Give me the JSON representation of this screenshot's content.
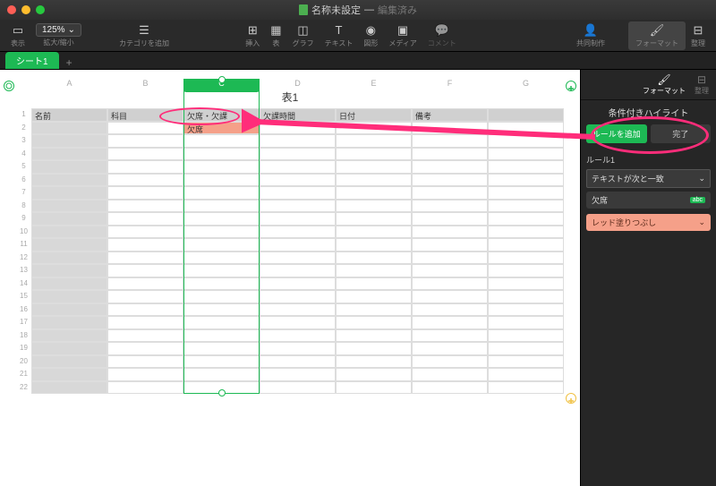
{
  "window": {
    "title": "名称未設定",
    "edited": "編集済み"
  },
  "toolbar": {
    "view": "表示",
    "zoom": "125%",
    "zoom_lbl": "拡大/縮小",
    "category": "カテゴリを追加",
    "insert": "挿入",
    "table": "表",
    "chart": "グラフ",
    "text": "テキスト",
    "shape": "図形",
    "media": "メディア",
    "comment": "コメント",
    "collab": "共同制作",
    "format": "フォーマット",
    "organize": "整理"
  },
  "tabs": {
    "sheet1": "シート1"
  },
  "table": {
    "title": "表1",
    "cols": [
      "A",
      "B",
      "C",
      "D",
      "E",
      "F",
      "G"
    ],
    "headers": [
      "名前",
      "科目",
      "欠席・欠課",
      "欠課時間",
      "日付",
      "備考",
      ""
    ],
    "row2_c": "欠席",
    "row_count": 22
  },
  "sidebar": {
    "format": "フォーマット",
    "organize": "整理",
    "title": "条件付きハイライト",
    "add_rule": "ルールを追加",
    "done": "完了",
    "rule_label": "ルール1",
    "condition": "テキストが次と一致",
    "value": "欠席",
    "badge": "abc",
    "fill": "レッド塗りつぶし"
  }
}
